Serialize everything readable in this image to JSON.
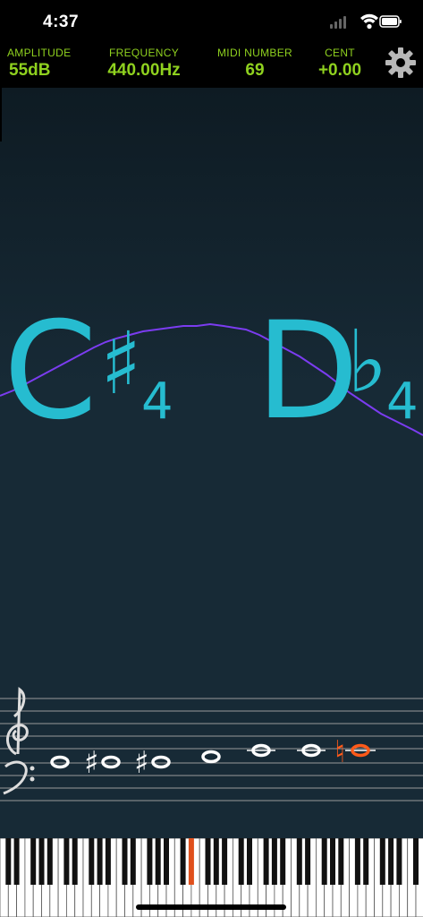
{
  "status": {
    "time": "4:37",
    "icons": [
      "signal-icon",
      "wifi-icon",
      "battery-icon"
    ]
  },
  "readouts": {
    "amplitude": {
      "label": "AMPLITUDE",
      "value": "55dB"
    },
    "frequency": {
      "label": "FREQUENCY",
      "value": "440.00Hz"
    },
    "midi": {
      "label": "MIDI NUMBER",
      "value": "69"
    },
    "cent": {
      "label": "CENT",
      "value": "+0.00"
    }
  },
  "notes": {
    "primary": {
      "letter": "C",
      "accidental": "♯",
      "octave": "4"
    },
    "secondary": {
      "letter": "D",
      "accidental": "♭",
      "octave": "4"
    }
  },
  "staff": {
    "notehead_glyph": "o",
    "sharp_glyph": "♯",
    "natural_glyph": "♮",
    "active_color": "#ff5a1a"
  },
  "piano": {
    "active_key_color": "#e0501c"
  },
  "colors": {
    "accent": "#8fd11f",
    "note": "#26bcd0",
    "curve": "#7b3cf0",
    "background": "#172a36"
  }
}
